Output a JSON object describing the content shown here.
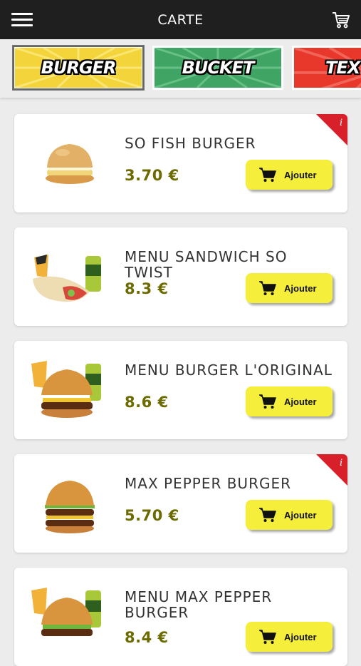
{
  "header": {
    "title": "CARTE",
    "menu_icon": "hamburger-menu-icon",
    "cart_icon": "shopping-cart-icon"
  },
  "categories": [
    {
      "label": "BURGER",
      "color": "#f4d43b",
      "active": true
    },
    {
      "label": "BUCKET",
      "color": "#3fa464",
      "active": false
    },
    {
      "label": "TEX M",
      "color": "#e8372b",
      "active": false
    }
  ],
  "colors": {
    "topbar": "#1f1f1f",
    "button": "#f5ee3a",
    "price": "#6b6b00",
    "info_badge": "#d8202a"
  },
  "add_label": "Ajouter",
  "products": [
    {
      "name": "SO FISH BURGER",
      "price": "3.70 €",
      "info": true,
      "image": "fish-burger"
    },
    {
      "name": "MENU SANDWICH SO TWIST",
      "price": "8.3 €",
      "info": false,
      "image": "menu-wrap"
    },
    {
      "name": "MENU BURGER L'ORIGINAL",
      "price": "8.6 €",
      "info": false,
      "image": "menu-burger"
    },
    {
      "name": "MAX PEPPER BURGER",
      "price": "5.70 €",
      "info": true,
      "image": "double-burger"
    },
    {
      "name": "MENU MAX PEPPER BURGER",
      "price": "8.4 €",
      "info": false,
      "image": "menu-burger"
    }
  ]
}
